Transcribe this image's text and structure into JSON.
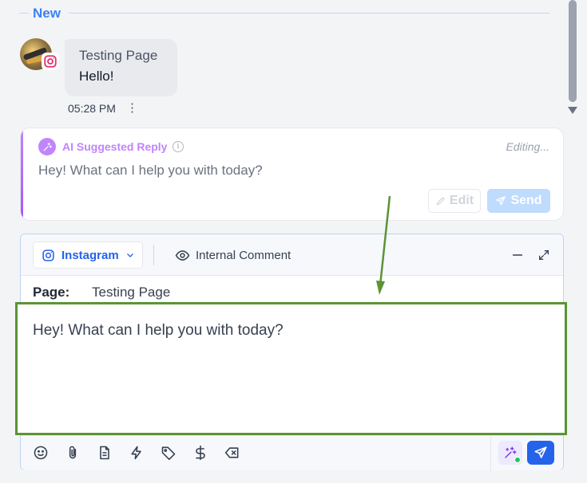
{
  "divider": {
    "label": "New"
  },
  "message": {
    "sender_page": "Testing Page",
    "text": "Hello!",
    "time": "05:28 PM",
    "more": "⋮"
  },
  "ai_reply": {
    "title": "AI Suggested Reply",
    "info": "i",
    "status": "Editing...",
    "text": "Hey! What can I help you with today?",
    "edit_label": "Edit",
    "send_label": "Send"
  },
  "composer": {
    "channel_label": "Instagram",
    "internal_comment_label": "Internal Comment",
    "page_key": "Page:",
    "page_value": "Testing Page",
    "reply_text": "Hey! What can I help you with today?"
  },
  "colors": {
    "accent_blue": "#2563eb",
    "ai_purple": "#c084fc",
    "highlight_green": "#5a9434",
    "instagram": "#e1306c"
  },
  "icons": {
    "toolbar": [
      "emoji-icon",
      "attachment-icon",
      "document-icon",
      "lightning-icon",
      "tag-icon",
      "dollar-icon",
      "clear-icon"
    ]
  }
}
